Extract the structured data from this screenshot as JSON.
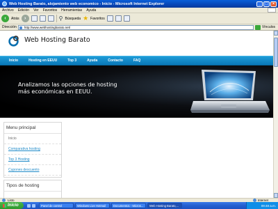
{
  "window": {
    "title": "Web Hosting Barato, alojamiento web economico - Inicio - Microsoft Internet Explorer"
  },
  "menu": [
    "Archivo",
    "Edición",
    "Ver",
    "Favoritos",
    "Herramientas",
    "Ayuda"
  ],
  "toolbar": {
    "back": "Atrás",
    "search": "Búsqueda",
    "favorites": "Favoritos"
  },
  "address": {
    "label": "Dirección",
    "url": "http://www.webhostingbarato.net/",
    "links": "Vínculos"
  },
  "site": {
    "name": "Web Hosting Barato",
    "nav": [
      "Inicio",
      "Hosting en EEUU",
      "Top 3",
      "Ayuda",
      "Contacto",
      "FAQ"
    ],
    "hero_line1": "Analizamos las opciones de hosting",
    "hero_line2": "más económicas en EEUU.",
    "menu_title": "Menu principal",
    "menu_items": [
      "Inicio",
      "Comparativa hosting",
      "Top 3 Hosting",
      "Cupones descuento"
    ],
    "box2_title": "Tipos de hosting"
  },
  "status": {
    "left": "Listo",
    "zone": "Internet"
  },
  "taskbar": {
    "start": "Inicio",
    "tasks": [
      "Panel de control",
      "Windows Live Hotmail",
      "Documento1 - Micros...",
      "Web Hosting Barato,..."
    ],
    "clock": "09:48 a.m."
  }
}
